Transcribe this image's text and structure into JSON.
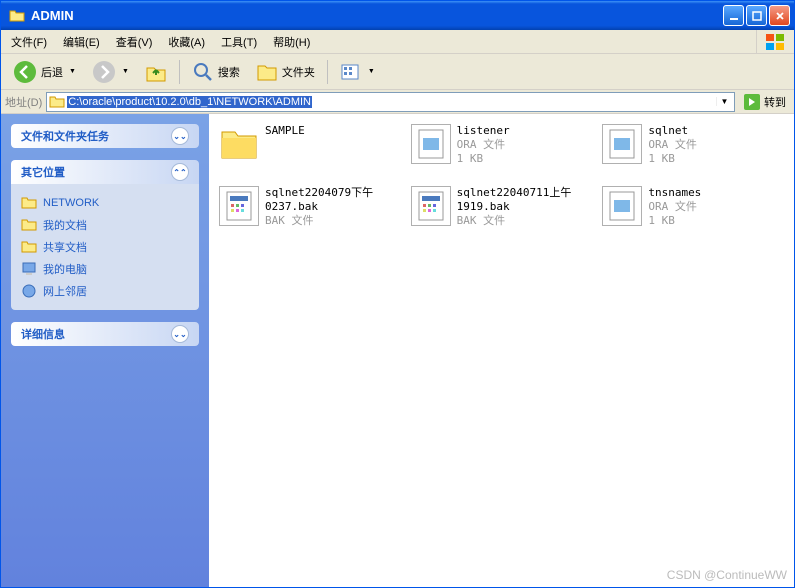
{
  "titlebar": {
    "title": "ADMIN"
  },
  "menu": {
    "file": "文件(F)",
    "edit": "编辑(E)",
    "view": "查看(V)",
    "favorites": "收藏(A)",
    "tools": "工具(T)",
    "help": "帮助(H)"
  },
  "toolbar": {
    "back": "后退",
    "search": "搜索",
    "folders": "文件夹"
  },
  "addressbar": {
    "label": "地址(D)",
    "path": "C:\\oracle\\product\\10.2.0\\db_1\\NETWORK\\ADMIN",
    "go": "转到"
  },
  "sidebar": {
    "tasks_title": "文件和文件夹任务",
    "other_title": "其它位置",
    "other_links": [
      {
        "label": "NETWORK",
        "icon": "folder"
      },
      {
        "label": "我的文档",
        "icon": "docs"
      },
      {
        "label": "共享文档",
        "icon": "shared"
      },
      {
        "label": "我的电脑",
        "icon": "computer"
      },
      {
        "label": "网上邻居",
        "icon": "network"
      }
    ],
    "detail_title": "详细信息"
  },
  "files": [
    {
      "name": "SAMPLE",
      "type": "folder",
      "line2": "",
      "line3": ""
    },
    {
      "name": "listener",
      "type": "ora",
      "line2": "ORA 文件",
      "line3": "1 KB"
    },
    {
      "name": "sqlnet",
      "type": "ora",
      "line2": "ORA 文件",
      "line3": "1 KB"
    },
    {
      "name": "sqlnet2204079下午0237.bak",
      "type": "bak",
      "line2": "BAK 文件",
      "line3": ""
    },
    {
      "name": "sqlnet22040711上午1919.bak",
      "type": "bak",
      "line2": "BAK 文件",
      "line3": ""
    },
    {
      "name": "tnsnames",
      "type": "ora",
      "line2": "ORA 文件",
      "line3": "1 KB"
    }
  ],
  "watermark": "CSDN @ContinueWW"
}
